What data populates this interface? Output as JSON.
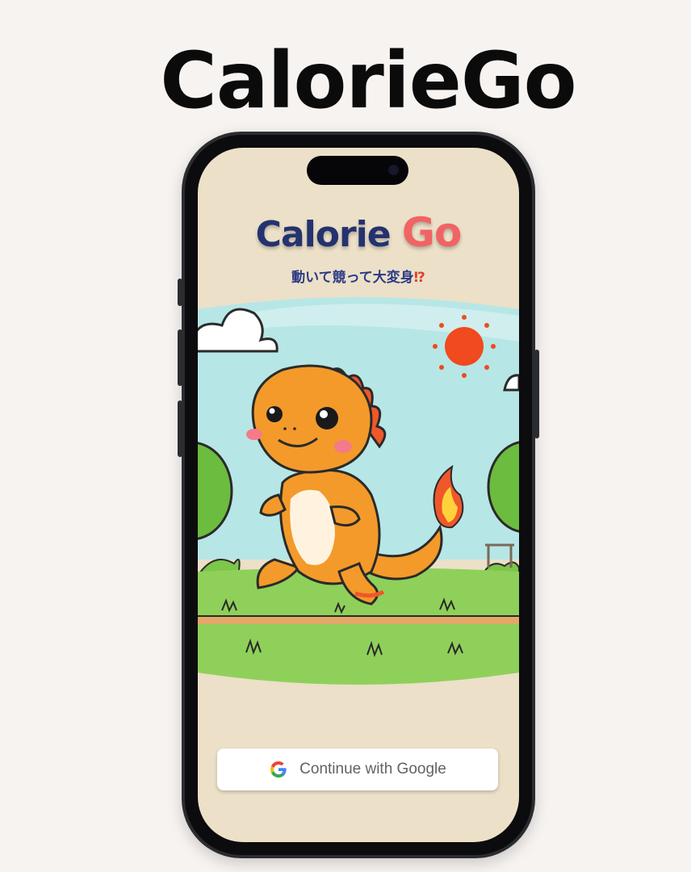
{
  "page": {
    "title": "CalorieGo"
  },
  "app": {
    "logo_part1": "Calorie",
    "logo_part2": "Go",
    "tagline_text": "動いて競って大変身",
    "tagline_mark": "⁉",
    "illustration": "running-orange-dinosaur-mascot"
  },
  "signin": {
    "google_icon": "google-g-icon",
    "google_label": "Continue with Google"
  },
  "colors": {
    "background": "#f7f3f1",
    "screen_bg": "#ece0c8",
    "logo_navy": "#24326f",
    "logo_red": "#f06464",
    "tagline_blue": "#2b3a86",
    "dino_orange": "#f39a2a",
    "sun_red": "#f04a1e",
    "grass_green": "#76c24a"
  }
}
